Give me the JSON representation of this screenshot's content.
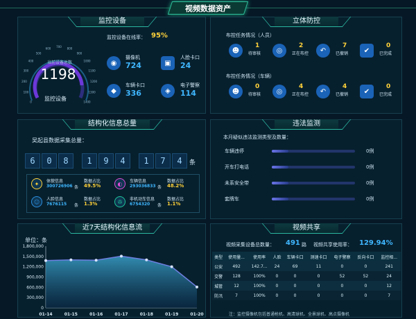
{
  "page_title": "视频数据资产",
  "monitor": {
    "title": "监控设备",
    "online_rate_label": "监控设备在线率：",
    "online_rate_value": "95%",
    "gauge_small_label": "当前设备总数",
    "gauge_value": "1198",
    "gauge_label": "监控设备",
    "gauge_ticks": [
      "0",
      "100",
      "200",
      "300",
      "400",
      "500",
      "600",
      "700",
      "800",
      "900",
      "1000",
      "1100",
      "1200",
      "1300",
      "1400"
    ],
    "items": [
      {
        "label": "摄像机",
        "value": "724",
        "icon": "camera-icon"
      },
      {
        "label": "人脸卡口",
        "value": "24",
        "icon": "face-scan-icon"
      },
      {
        "label": "车辆卡口",
        "value": "336",
        "icon": "car-icon"
      },
      {
        "label": "电子警察",
        "value": "114",
        "icon": "shield-icon"
      }
    ]
  },
  "stereo": {
    "title": "立体防控",
    "person_label": "布控任务情况（人员）",
    "vehicle_label": "布控任务情况（车辆）",
    "person": [
      {
        "value": "1",
        "label": "待审核",
        "icon": "user-icon"
      },
      {
        "value": "2",
        "label": "正在布控",
        "icon": "target-icon"
      },
      {
        "value": "7",
        "label": "已撤销",
        "icon": "undo-icon"
      },
      {
        "value": "0",
        "label": "已完成",
        "icon": "check-icon"
      }
    ],
    "vehicle": [
      {
        "value": "0",
        "label": "待审核",
        "icon": "user-icon"
      },
      {
        "value": "4",
        "label": "正在布控",
        "icon": "target-icon"
      },
      {
        "value": "4",
        "label": "已撤销",
        "icon": "undo-icon"
      },
      {
        "value": "0",
        "label": "已完成",
        "icon": "check-icon"
      }
    ]
  },
  "structured": {
    "title": "结构化信息总量",
    "subtitle": "吴起县数据采集总量：",
    "digits": [
      "6",
      "0",
      "8",
      "1",
      "9",
      "4",
      "1",
      "7",
      "4"
    ],
    "unit": "条",
    "items": [
      {
        "name": "体貌信息",
        "count": "300726906",
        "unit": "条",
        "share_label": "数据占比",
        "share": "49.5%",
        "icon": "person-walk-icon",
        "color": "#ffd23a"
      },
      {
        "name": "车辆信息",
        "count": "293036833",
        "unit": "条",
        "share_label": "数据占比",
        "share": "48.2%",
        "icon": "vehicle-icon",
        "color": "#e04bd6"
      },
      {
        "name": "人脸信息",
        "count": "7676115",
        "unit": "条",
        "share_label": "数据占比",
        "share": "1.3%",
        "icon": "face-icon",
        "color": "#2b8fe0"
      },
      {
        "name": "非机动车信息",
        "count": "6754320",
        "unit": "条",
        "share_label": "数据占比",
        "share": "1.1%",
        "icon": "bike-icon",
        "color": "#1fc79a"
      }
    ]
  },
  "illegal": {
    "title": "违法监测",
    "subtitle": "本月疑似违法监测类型及数量：",
    "items": [
      {
        "label": "车辆违停",
        "value": "0例",
        "fill": 0.2
      },
      {
        "label": "开车打电话",
        "value": "0例",
        "fill": 0.2
      },
      {
        "label": "未系安全带",
        "value": "0例",
        "fill": 0.2
      },
      {
        "label": "套牌车",
        "value": "0例",
        "fill": 0.2
      }
    ]
  },
  "flow": {
    "title": "近7天结构化信息流",
    "unit_label": "单位：条"
  },
  "chart_data": {
    "type": "area",
    "title": "",
    "ylabel": "单位：条",
    "categories": [
      "01-14",
      "01-15",
      "01-16",
      "01-17",
      "01-18",
      "01-19",
      "01-20"
    ],
    "values": [
      1380000,
      1400000,
      1390000,
      1510000,
      1400000,
      1200000,
      610000
    ],
    "ylim": [
      0,
      1800000
    ],
    "yticks": [
      "0",
      "300,000",
      "600,000",
      "900,000",
      "1,200,000",
      "1,500,000",
      "1,800,000"
    ],
    "grid": false
  },
  "share": {
    "title": "视频共享",
    "total_label": "视频采集设备总数量：",
    "total_value": "491",
    "total_unit": "路",
    "rate_label": "视频共享使用率：",
    "rate_value": "129.94%",
    "columns": [
      "类型",
      "使用量...",
      "使用率",
      "人脸",
      "车辆卡口",
      "测速卡口",
      "电子警察",
      "反向卡口",
      "监控相..."
    ],
    "rows": [
      [
        "公安",
        "492",
        "142.7...",
        "24",
        "69",
        "11",
        "0",
        "0",
        "241"
      ],
      [
        "交警",
        "128",
        "100%",
        "0",
        "0",
        "0",
        "52",
        "52",
        "24"
      ],
      [
        "城管",
        "12",
        "100%",
        "0",
        "0",
        "0",
        "0",
        "0",
        "12"
      ],
      [
        "防汛",
        "7",
        "100%",
        "0",
        "0",
        "0",
        "0",
        "0",
        "7"
      ]
    ],
    "note": "注：监控摄像机包括普通枪机、高清球机、全景球机、高点摄像机"
  }
}
